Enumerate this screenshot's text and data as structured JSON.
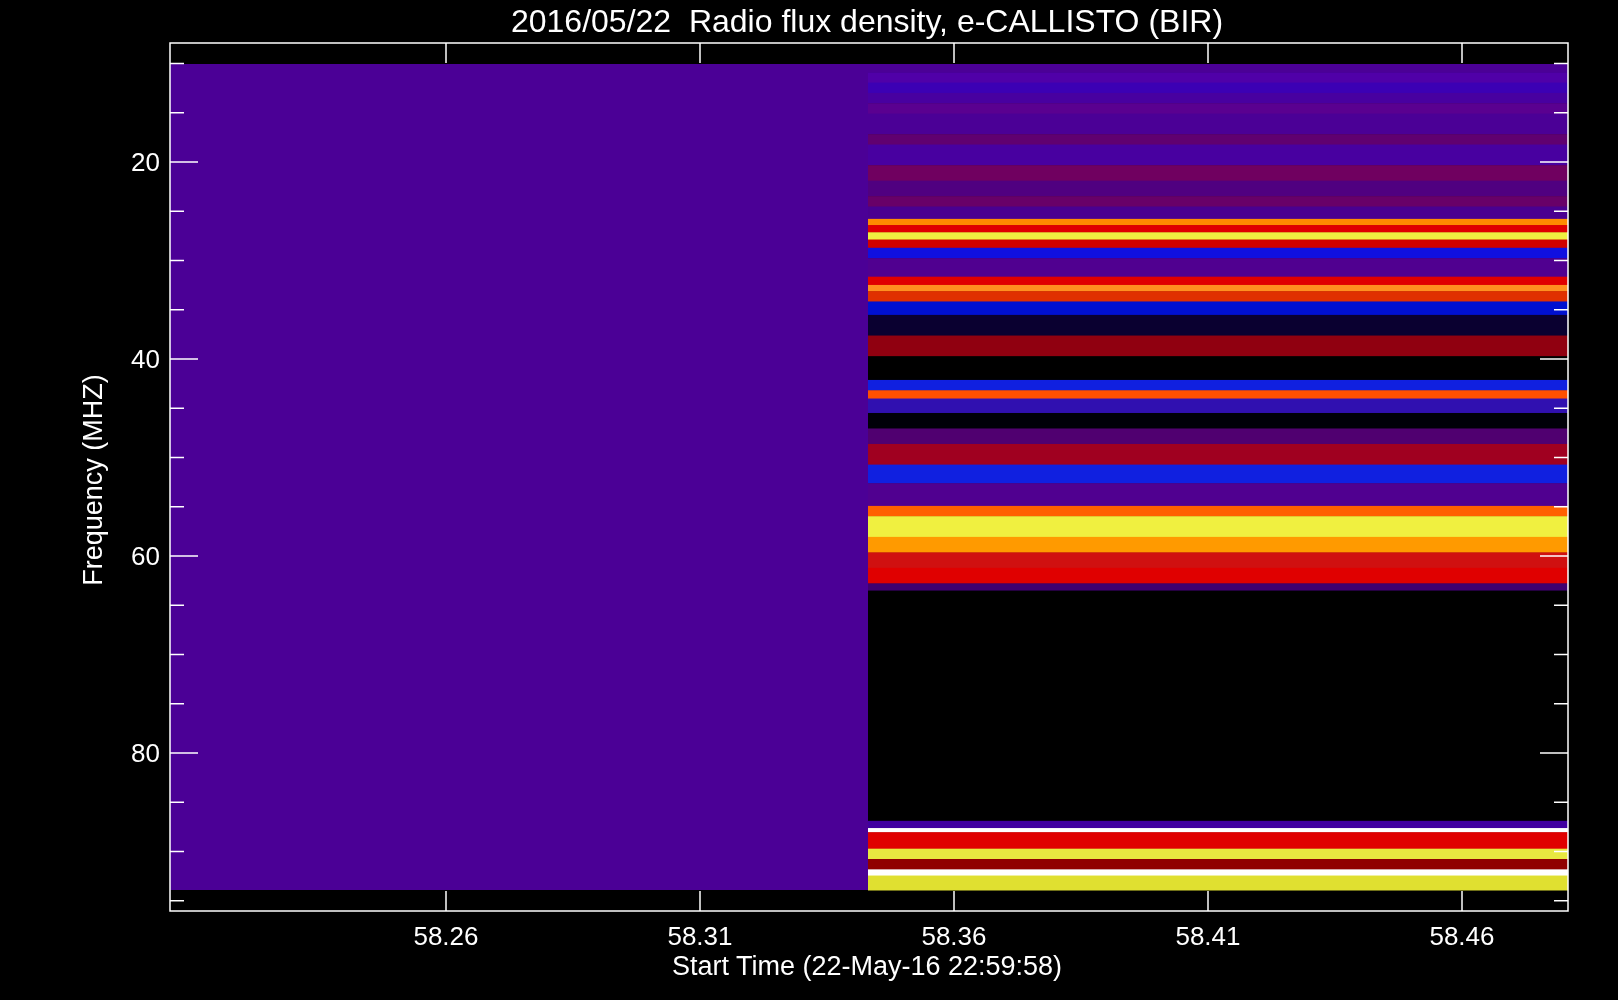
{
  "title": "2016/05/22  Radio flux density, e-CALLISTO (BIR)",
  "y_axis": {
    "label": "Frequency (MHZ)",
    "ticks": [
      "20",
      "40",
      "60",
      "80"
    ]
  },
  "x_axis": {
    "label": "Start Time (22-May-16 22:59:58)",
    "ticks": [
      "58.26",
      "58.31",
      "58.36",
      "58.41",
      "58.46"
    ]
  }
}
